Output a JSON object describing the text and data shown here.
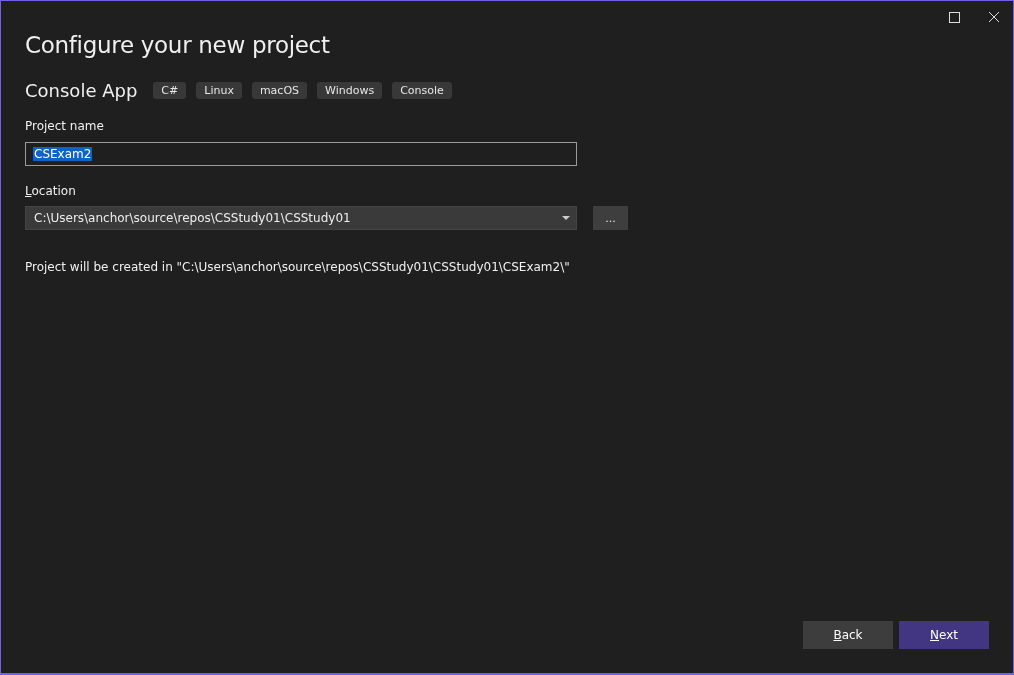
{
  "window": {
    "title": "Configure your new project"
  },
  "template": {
    "name": "Console App",
    "tags": [
      "C#",
      "Linux",
      "macOS",
      "Windows",
      "Console"
    ]
  },
  "project_name": {
    "label": "Project name",
    "value": "CSExam2",
    "text_selected": true
  },
  "location": {
    "label": "Location",
    "mnemonic_underlined": true,
    "value": "C:\\Users\\anchor\\source\\repos\\CSStudy01\\CSStudy01",
    "browse_button": "..."
  },
  "summary": "Project will be created in \"C:\\Users\\anchor\\source\\repos\\CSStudy01\\CSStudy01\\CSExam2\\\"",
  "buttons": [
    {
      "label": "Back",
      "kind": "secondary",
      "mnemonic_underlined": true
    },
    {
      "label": "Next",
      "kind": "primary",
      "mnemonic_underlined": true
    }
  ]
}
